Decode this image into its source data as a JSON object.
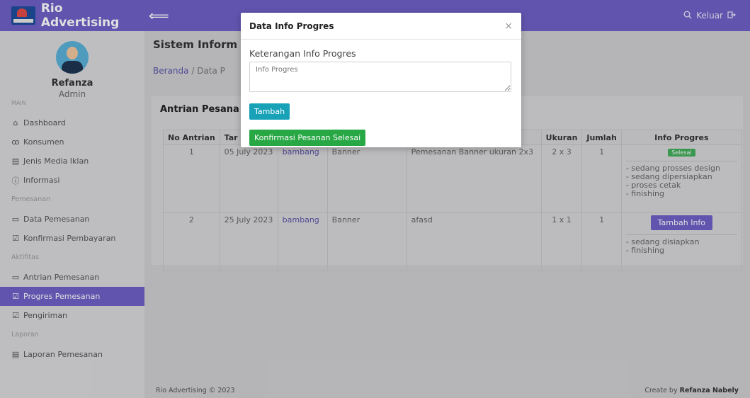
{
  "header": {
    "brand": "Rio Advertising",
    "toggle_glyph": "⟸",
    "logout_label": "Keluar"
  },
  "profile": {
    "name": "Refanza",
    "role": "Admin"
  },
  "sidebar": {
    "sections": [
      "MAIN",
      "Pemesanan",
      "Aktifitas",
      "Laporan"
    ],
    "items": [
      {
        "label": "Dashboard",
        "icon": "home-icon"
      },
      {
        "label": "Konsumen",
        "icon": "users-icon"
      },
      {
        "label": "Jenis Media Iklan",
        "icon": "list-icon"
      },
      {
        "label": "Informasi",
        "icon": "info-icon"
      },
      {
        "label": "Data Pemesanan",
        "icon": "calendar-icon"
      },
      {
        "label": "Konfirmasi Pembayaran",
        "icon": "check-icon"
      },
      {
        "label": "Antrian Pemesanan",
        "icon": "calendar-icon"
      },
      {
        "label": "Progres Pemesanan",
        "icon": "check-icon",
        "active": true
      },
      {
        "label": "Pengiriman",
        "icon": "check-icon"
      },
      {
        "label": "Laporan Pemesanan",
        "icon": "list-icon"
      }
    ]
  },
  "main": {
    "page_title": "Sistem Inform",
    "breadcrumb": {
      "home": "Beranda",
      "sep": "/",
      "current": "Data P"
    },
    "card_title": "Antrian Pesana",
    "table": {
      "headers": [
        "No Antrian",
        "Tar",
        "Ukuran",
        "Jumlah",
        "Info Progres"
      ],
      "rows": [
        {
          "no": "1",
          "tanggal": "05 July 2023",
          "konsumen": "bambang",
          "media": "Banner",
          "keterangan": "Pemesanan Banner ukuran 2x3",
          "ukuran": "2 x 3",
          "jumlah": "1",
          "status": "Selesai",
          "progres": [
            "- sedang prosses design",
            "- sedang dipersiapkan",
            "- proses cetak",
            "- finishing"
          ]
        },
        {
          "no": "2",
          "tanggal": "25 July 2023",
          "konsumen": "bambang",
          "media": "Banner",
          "keterangan": "afasd",
          "ukuran": "1 x 1",
          "jumlah": "1",
          "action": "Tambah Info",
          "progres": [
            "- sedang disiapkan",
            "- finishing"
          ]
        }
      ]
    }
  },
  "footer": {
    "left": "Rio Advertising © 2023",
    "right_prefix": "Create by",
    "right_name": "Refanza Nabely"
  },
  "modal": {
    "title": "Data Info Progres",
    "close": "×",
    "field_label": "Keterangan Info Progres",
    "field_placeholder": "Info Progres",
    "add_button": "Tambah",
    "confirm_button": "Konfirmasi Pesanan Selesai"
  },
  "colors": {
    "primary": "#6f60c8",
    "info": "#17a2b8",
    "success": "#28a745"
  }
}
